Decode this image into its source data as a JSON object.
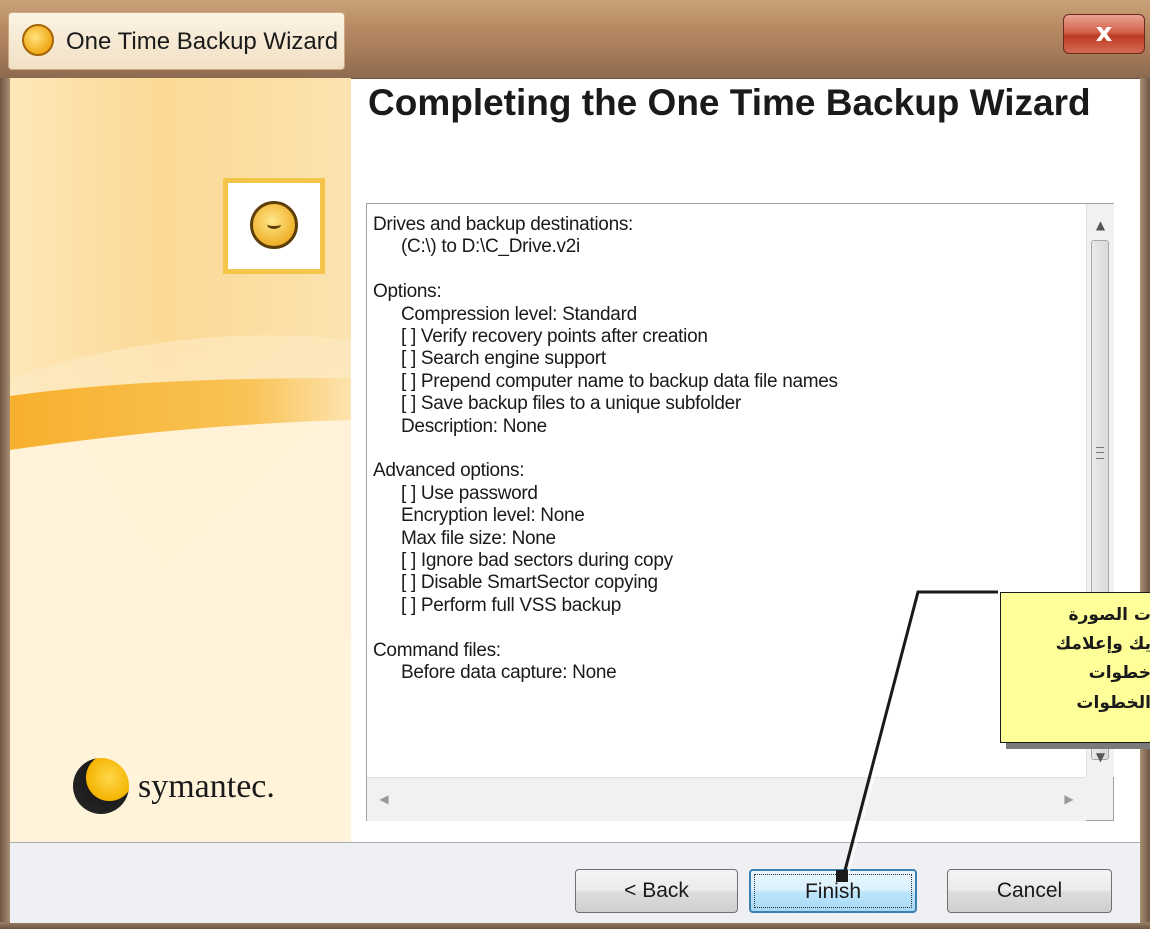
{
  "window": {
    "title": "One Time Backup Wizard",
    "close_label": "x"
  },
  "banner": {
    "brand": "symantec."
  },
  "content": {
    "title": "Completing the One Time Backup Wizard"
  },
  "summary": {
    "lines": [
      {
        "text": "Drives and backup destinations:",
        "indent": 0
      },
      {
        "text": "(C:\\) to D:\\C_Drive.v2i",
        "indent": 1
      },
      {
        "text": "",
        "indent": 0
      },
      {
        "text": "Options:",
        "indent": 0
      },
      {
        "text": "Compression level: Standard",
        "indent": 1
      },
      {
        "text": "[ ] Verify recovery points after creation",
        "indent": 1
      },
      {
        "text": "[ ] Search engine support",
        "indent": 1
      },
      {
        "text": "[ ] Prepend computer name to backup data file names",
        "indent": 1
      },
      {
        "text": "[ ] Save backup files to a unique subfolder",
        "indent": 1
      },
      {
        "text": "Description: None",
        "indent": 1
      },
      {
        "text": "",
        "indent": 0
      },
      {
        "text": "Advanced options:",
        "indent": 0
      },
      {
        "text": "[ ] Use password",
        "indent": 1
      },
      {
        "text": "Encryption level: None",
        "indent": 1
      },
      {
        "text": "Max file size: None",
        "indent": 1
      },
      {
        "text": "[ ] Ignore bad sectors during copy",
        "indent": 1
      },
      {
        "text": "[ ] Disable SmartSector copying",
        "indent": 1
      },
      {
        "text": "[ ] Perform full VSS backup",
        "indent": 1
      },
      {
        "text": "",
        "indent": 0
      },
      {
        "text": "Command files:",
        "indent": 0
      },
      {
        "text": "Before data capture: None",
        "indent": 1
      }
    ],
    "scroll_up": "▲",
    "scroll_down": "▼",
    "scroll_left": "◀",
    "scroll_right": "▶"
  },
  "buttons": {
    "back": "< Back",
    "finish": "Finish",
    "cancel": "Cancel"
  },
  "annotation": {
    "lines": [
      "ت الصورة",
      "يك وإعلامك",
      "خطوات",
      "الخطوات"
    ]
  },
  "icons": {
    "title": "norton-ghost-icon",
    "logo": "norton-ghost-logo-icon",
    "brand": "symantec-logo-icon"
  }
}
